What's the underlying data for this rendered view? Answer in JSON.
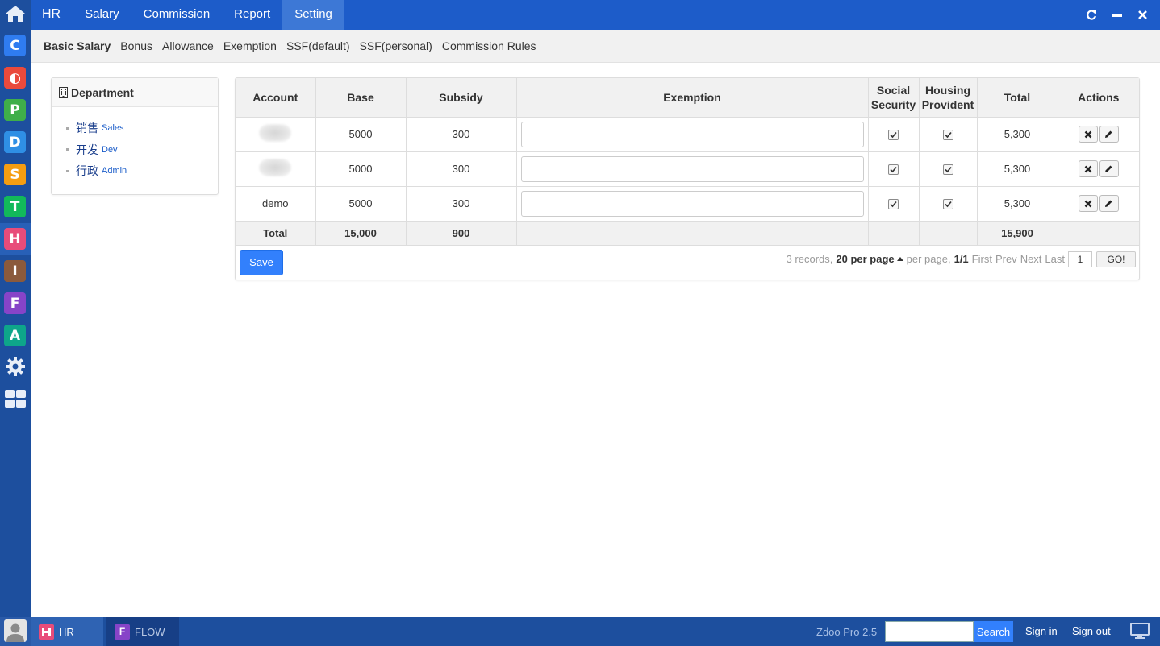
{
  "topbar": {
    "brand": "HR",
    "items": [
      {
        "label": "Salary",
        "active": false
      },
      {
        "label": "Commission",
        "active": false
      },
      {
        "label": "Report",
        "active": false
      },
      {
        "label": "Setting",
        "active": true
      }
    ]
  },
  "subnav": {
    "items": [
      {
        "label": "Basic Salary",
        "active": true
      },
      {
        "label": "Bonus",
        "active": false
      },
      {
        "label": "Allowance",
        "active": false
      },
      {
        "label": "Exemption",
        "active": false
      },
      {
        "label": "SSF(default)",
        "active": false
      },
      {
        "label": "SSF(personal)",
        "active": false
      },
      {
        "label": "Commission Rules",
        "active": false
      }
    ]
  },
  "dock": {
    "apps": [
      {
        "letter": "C",
        "color": "#2f7cf0",
        "icon": "app-c-icon"
      },
      {
        "letter": "◐",
        "color": "#ea4a3c",
        "icon": "app-o-icon"
      },
      {
        "letter": "P",
        "color": "#3fae49",
        "icon": "app-p-icon"
      },
      {
        "letter": "D",
        "color": "#2f8fe5",
        "icon": "app-d-icon"
      },
      {
        "letter": "S",
        "color": "#f59d11",
        "icon": "app-s-icon"
      },
      {
        "letter": "T",
        "color": "#12b95a",
        "icon": "app-t-icon"
      },
      {
        "letter": "H",
        "color": "#e84c7a",
        "icon": "app-hr-icon"
      },
      {
        "letter": "I",
        "color": "#8b5a3c",
        "icon": "app-i-icon"
      },
      {
        "letter": "F",
        "color": "#8744c8",
        "icon": "app-flow-icon"
      },
      {
        "letter": "A",
        "color": "#0ea68a",
        "icon": "app-a-icon"
      }
    ]
  },
  "department": {
    "title": "Department",
    "items": [
      {
        "zh": "销售",
        "en": "Sales"
      },
      {
        "zh": "开发",
        "en": "Dev"
      },
      {
        "zh": "行政",
        "en": "Admin"
      }
    ]
  },
  "table": {
    "headers": {
      "account": "Account",
      "base": "Base",
      "subsidy": "Subsidy",
      "exemption": "Exemption",
      "social_l1": "Social",
      "social_l2": "Security",
      "housing_l1": "Housing",
      "housing_l2": "Provident",
      "total": "Total",
      "actions": "Actions"
    },
    "rows": [
      {
        "account": "",
        "blurred": true,
        "base": "5000",
        "subsidy": "300",
        "exemption": "",
        "social": true,
        "housing": true,
        "total": "5,300"
      },
      {
        "account": "",
        "blurred": true,
        "base": "5000",
        "subsidy": "300",
        "exemption": "",
        "social": true,
        "housing": true,
        "total": "5,300"
      },
      {
        "account": "demo",
        "blurred": false,
        "base": "5000",
        "subsidy": "300",
        "exemption": "",
        "social": true,
        "housing": true,
        "total": "5,300"
      }
    ],
    "footer": {
      "label": "Total",
      "base": "15,000",
      "subsidy": "900",
      "total": "15,900"
    }
  },
  "actions": {
    "save": "Save"
  },
  "pager": {
    "records": "3 records,",
    "per_page_value": "20 per page",
    "per_page_text": "per page,",
    "page_info": "1/1",
    "first": "First",
    "prev": "Prev",
    "next": "Next",
    "last": "Last",
    "page_input": "1",
    "go": "GO!"
  },
  "taskbar": {
    "tabs": [
      {
        "label": "HR",
        "letter": "H",
        "color": "#e84c7a",
        "active": true
      },
      {
        "label": "FLOW",
        "letter": "F",
        "color": "#8744c8",
        "active": false
      }
    ],
    "version": "Zdoo Pro 2.5",
    "search_button": "Search",
    "search_value": "",
    "sign_in": "Sign in",
    "sign_out": "Sign out"
  }
}
